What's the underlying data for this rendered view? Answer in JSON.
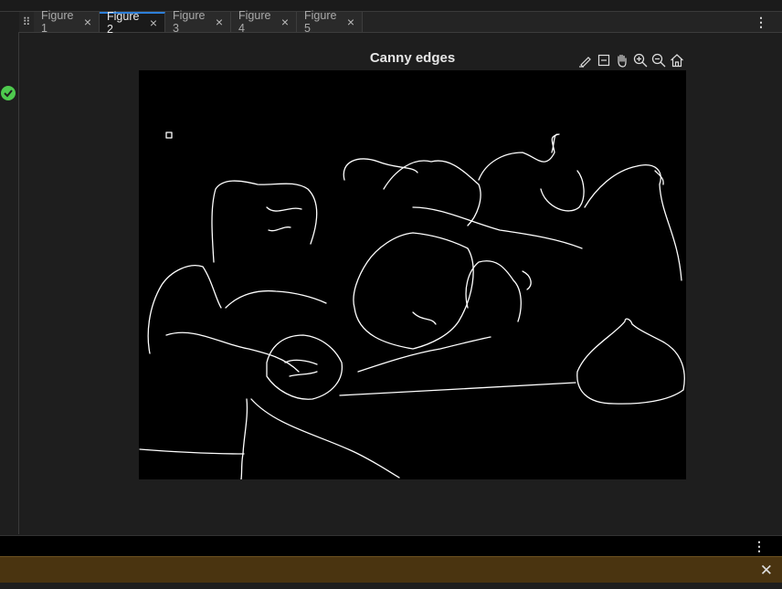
{
  "tabs": [
    {
      "label": "Figure 1",
      "active": false
    },
    {
      "label": "Figure 2",
      "active": true
    },
    {
      "label": "Figure 3",
      "active": false
    },
    {
      "label": "Figure 4",
      "active": false
    },
    {
      "label": "Figure 5",
      "active": false
    }
  ],
  "figure": {
    "title": "Canny edges"
  },
  "toolbar": {
    "icons": [
      "brush-icon",
      "data-tip-icon",
      "pan-hand-icon",
      "zoom-in-icon",
      "zoom-out-icon",
      "home-icon"
    ]
  },
  "colors": {
    "accent": "#2d7fd9",
    "status_ok": "#4ec94e",
    "notice_bg": "#4a3410"
  }
}
